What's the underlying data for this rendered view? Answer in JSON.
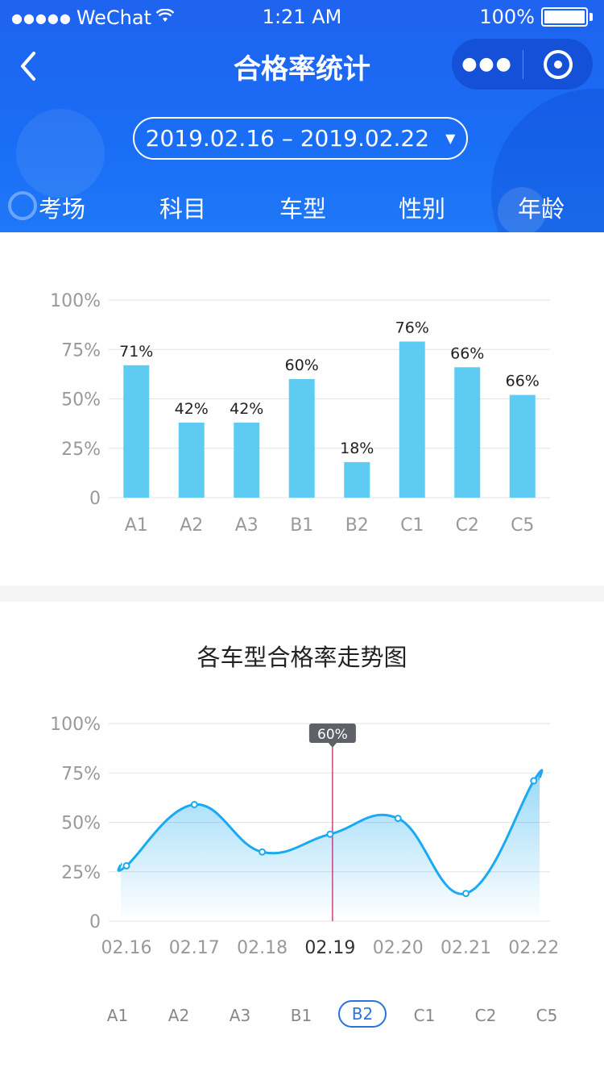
{
  "status_bar": {
    "carrier": "WeChat",
    "time": "1:21 AM",
    "battery": "100%"
  },
  "nav": {
    "title": "合格率统计"
  },
  "date_range": {
    "text": "2019.02.16 – 2019.02.22"
  },
  "tabs": [
    {
      "label": "考场"
    },
    {
      "label": "科目"
    },
    {
      "label": "车型",
      "active": true
    },
    {
      "label": "性别"
    },
    {
      "label": "年龄"
    }
  ],
  "chart_data": [
    {
      "type": "bar",
      "categories": [
        "A1",
        "A2",
        "A3",
        "B1",
        "B2",
        "C1",
        "C2",
        "C5"
      ],
      "values": [
        67,
        38,
        38,
        60,
        18,
        79,
        66,
        52
      ],
      "data_labels": [
        "71%",
        "42%",
        "42%",
        "60%",
        "18%",
        "76%",
        "66%",
        "66%"
      ],
      "y_ticks": [
        "100%",
        "75%",
        "50%",
        "25%",
        "0"
      ],
      "ylim": [
        0,
        100
      ],
      "grid": true,
      "colors": {
        "bar": "#5ecbf2",
        "grid": "#e3e3e3",
        "tick": "#999999",
        "label": "#222222"
      }
    },
    {
      "type": "area",
      "title": "各车型合格率走势图",
      "x": [
        "02.16",
        "02.17",
        "02.18",
        "02.19",
        "02.20",
        "02.21",
        "02.22"
      ],
      "values": [
        28,
        59,
        35,
        44,
        52,
        14,
        71
      ],
      "y_ticks": [
        "100%",
        "75%",
        "50%",
        "25%",
        "0"
      ],
      "ylim": [
        0,
        100
      ],
      "grid": true,
      "highlight": {
        "index": 3,
        "label": "60%"
      },
      "colors": {
        "line": "#1aa9f2",
        "fill": "#1aa9f2",
        "marker": "#c2185b",
        "tooltip": "#5f6168",
        "tick": "#999999",
        "tick_active": "#333333"
      }
    }
  ],
  "legend": {
    "items": [
      "A1",
      "A2",
      "A3",
      "B1",
      "B2",
      "C1",
      "C2",
      "C5"
    ],
    "selected": "B2"
  }
}
